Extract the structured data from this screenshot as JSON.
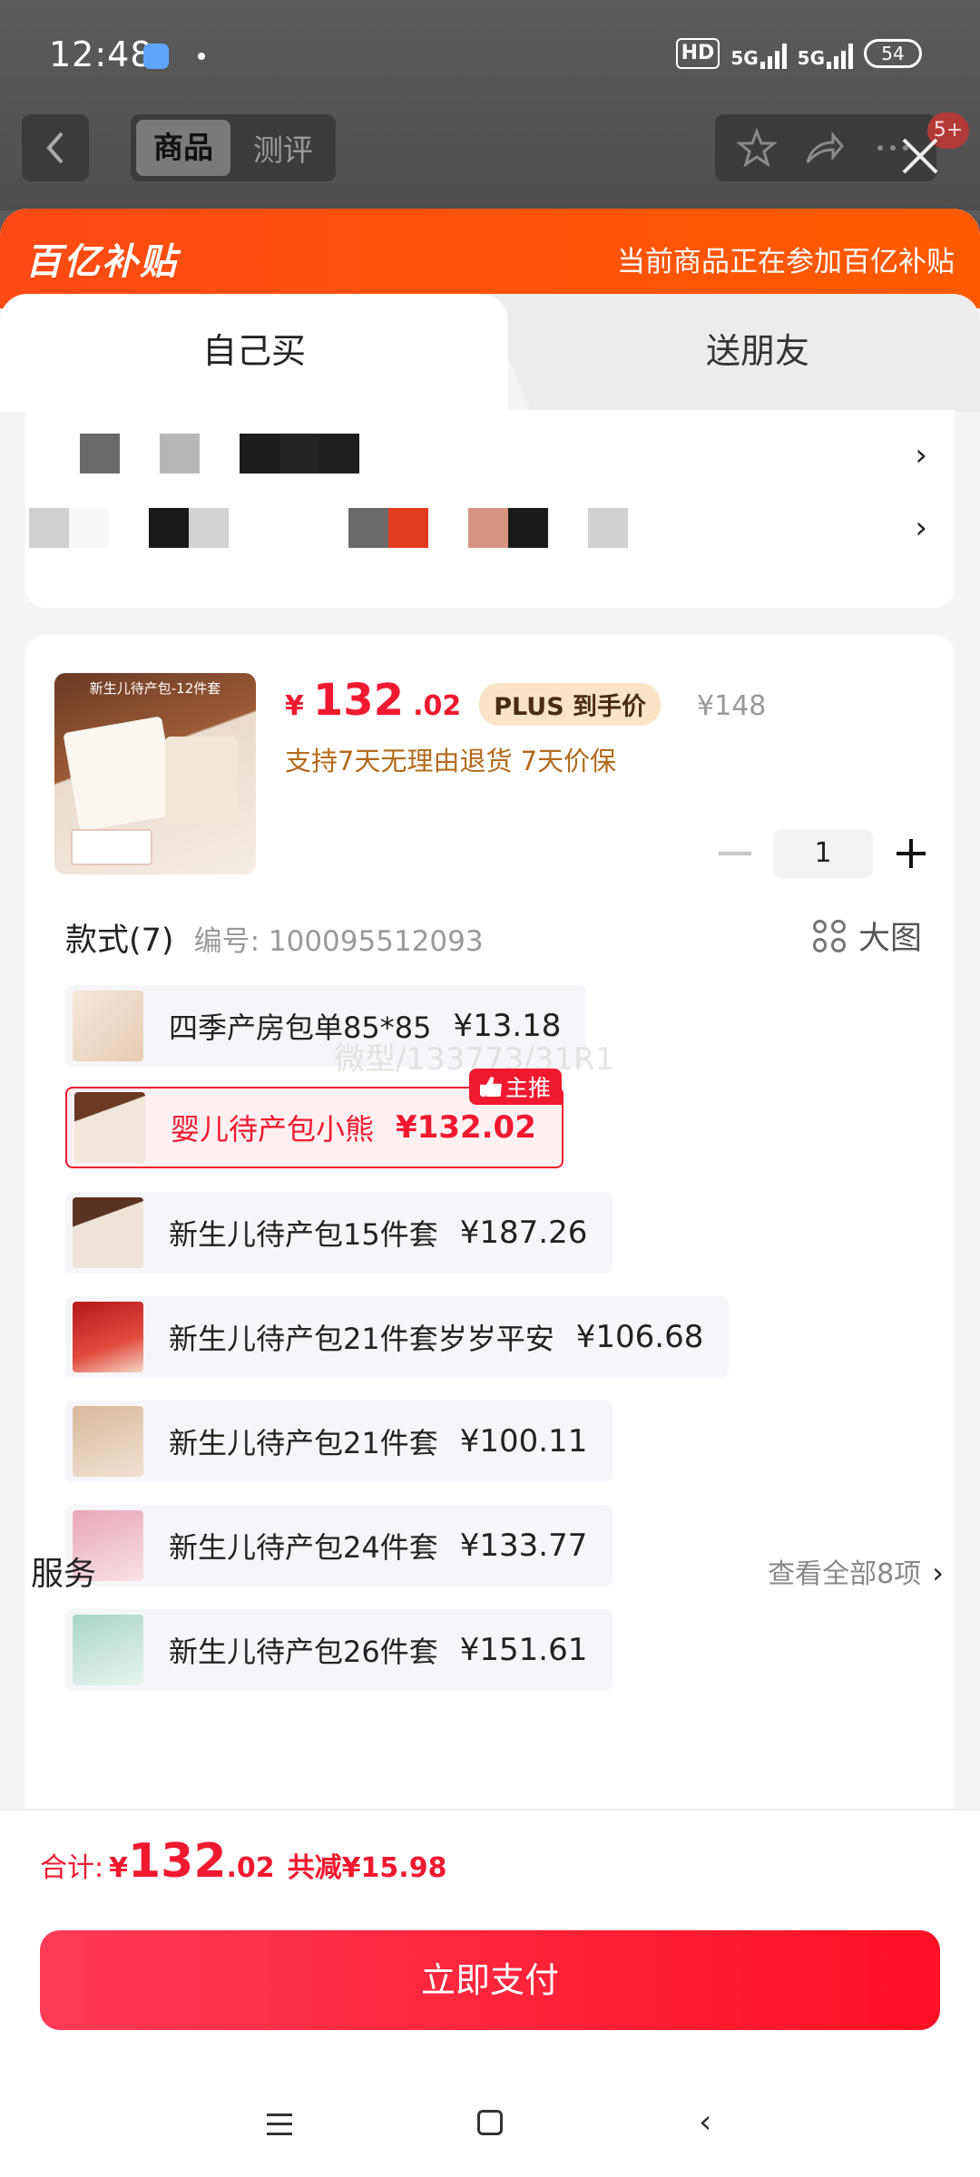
{
  "status_bar": {
    "time": "12:48",
    "hd": "HD",
    "net1": "5G",
    "net2": "5G",
    "battery": "54"
  },
  "top_nav": {
    "tabs": [
      "商品",
      "测评"
    ],
    "badge": "5+"
  },
  "banner": {
    "logo": "百亿补贴",
    "note": "当前商品正在参加百亿补贴"
  },
  "buy_tabs": {
    "self": "自己买",
    "gift": "送朋友"
  },
  "product": {
    "price_symbol": "¥",
    "price_int": "132",
    "price_dec": ".02",
    "plus_tag": "PLUS 到手价",
    "orig_price": "¥148",
    "perks": "支持7天无理由退货  7天价保",
    "thumb_caption": "新生儿待产包-12件套",
    "quantity": "1"
  },
  "styles": {
    "title": "款式(7)",
    "code": "编号: 100095512093",
    "bigview": "大图",
    "main_tag": "主推",
    "watermark": "微型/133773/31R1",
    "options": [
      {
        "label": "四季产房包单85*85",
        "price": "¥13.18"
      },
      {
        "label": "婴儿待产包小熊",
        "price": "¥132.02"
      },
      {
        "label": "新生儿待产包15件套",
        "price": "¥187.26"
      },
      {
        "label": "新生儿待产包21件套岁岁平安",
        "price": "¥106.68"
      },
      {
        "label": "新生儿待产包21件套",
        "price": "¥100.11"
      },
      {
        "label": "新生儿待产包24件套",
        "price": "¥133.77"
      },
      {
        "label": "新生儿待产包26件套",
        "price": "¥151.61"
      }
    ]
  },
  "service": {
    "title": "服务",
    "view_all": "查看全部8项",
    "chevron": "›"
  },
  "footer": {
    "total_label": "合计:",
    "total_symbol": "¥",
    "total_int": "132",
    "total_dec": ".02",
    "discount": "共减¥15.98",
    "pay_button": "立即支付"
  },
  "colors": {
    "accent": "#f0192f",
    "banner": "#ff4a14",
    "perk": "#b36a1b"
  }
}
